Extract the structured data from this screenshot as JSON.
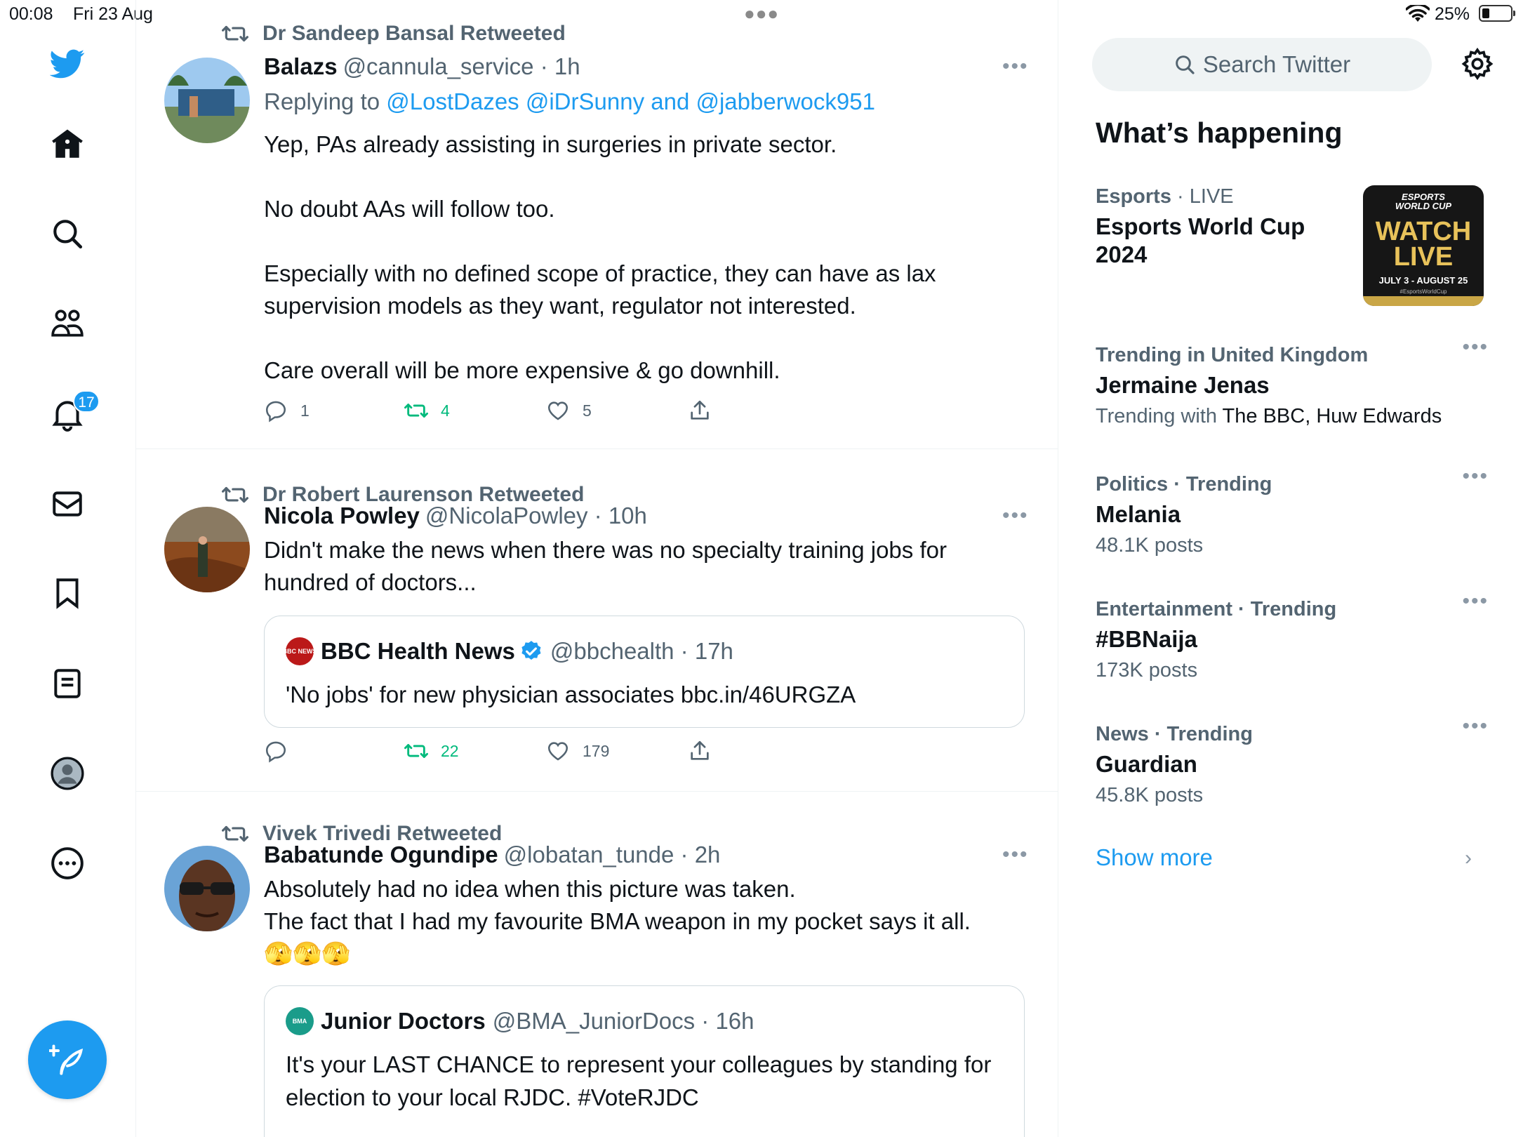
{
  "status_bar": {
    "time": "00:08",
    "date": "Fri 23 Aug",
    "battery": "25%"
  },
  "nav": {
    "notifications_badge": "17"
  },
  "tweets": [
    {
      "retweeted_by": "Dr Sandeep Bansal Retweeted",
      "name": "Balazs",
      "handle": "@cannula_service · 1h",
      "replying_prefix": "Replying to ",
      "replying_to": "@LostDazes @iDrSunny and @jabberwock951",
      "text": [
        "Yep, PAs already assisting in surgeries in private sector.",
        "",
        "No doubt AAs will follow too.",
        "",
        "Especially with no defined scope of practice, they can have as lax supervision models as they want, regulator not interested.",
        "",
        "Care overall will be more expensive & go downhill."
      ],
      "replies": "1",
      "retweets": "4",
      "likes": "5"
    },
    {
      "retweeted_by": "Dr Robert Laurenson Retweeted",
      "name": "Nicola Powley",
      "handle": "@NicolaPowley · 10h",
      "text": "Didn't make the news when there was no specialty training jobs for hundred of doctors...",
      "quote": {
        "name": "BBC Health News",
        "handle": "@bbchealth · 17h",
        "icon_label": "BBC NEWS",
        "text": "'No jobs' for new physician associates bbc.in/46URGZA"
      },
      "replies": "",
      "retweets": "22",
      "likes": "179"
    },
    {
      "retweeted_by": "Vivek Trivedi Retweeted",
      "name": "Babatunde Ogundipe",
      "handle": "@lobatan_tunde · 2h",
      "text": [
        "Absolutely had no idea when this picture was taken.",
        "The fact that I had my favourite BMA weapon in my pocket says it all.",
        "🫣🫣🫣"
      ],
      "quote": {
        "name": "Junior Doctors",
        "handle": "@BMA_JuniorDocs · 16h",
        "icon_label": "BMA",
        "text": "It's your LAST CHANCE to represent your colleagues by standing for election to your local RJDC. #VoteRJDC"
      }
    }
  ],
  "right": {
    "search_placeholder": "Search Twitter",
    "title": "What’s happening",
    "esports": {
      "cat": "Esports",
      "live": " · LIVE",
      "topic": "Esports World Cup 2024",
      "thumb_top": "ESPORTS WORLD CUP",
      "thumb_main": "WATCH LIVE",
      "thumb_dates": "JULY 3 - AUGUST 25",
      "thumb_tag": "#EsportsWorldCup"
    },
    "trends": [
      {
        "cat": "Trending in United Kingdom",
        "topic": "Jermaine Jenas",
        "count_prefix": "Trending with ",
        "count": "The BBC, Huw Edwards"
      },
      {
        "cat": "Politics · Trending",
        "topic": "Melania",
        "count": "48.1K posts"
      },
      {
        "cat": "Entertainment · Trending",
        "topic": "#BBNaija",
        "count": "173K posts"
      },
      {
        "cat": "News · Trending",
        "topic": "Guardian",
        "count": "45.8K posts"
      }
    ],
    "show_more": "Show more"
  },
  "colors": {
    "accent": "#1d9bf0",
    "retweet_green": "#00ba7c",
    "secondary_text": "#536471",
    "border": "#eff3f4"
  },
  "icons": [
    "twitter-logo-icon",
    "home-icon",
    "search-icon",
    "communities-icon",
    "notifications-icon",
    "messages-icon",
    "bookmarks-icon",
    "lists-icon",
    "profile-icon",
    "more-icon",
    "compose-icon",
    "retweet-icon",
    "reply-icon",
    "like-icon",
    "share-icon",
    "verified-icon",
    "settings-icon",
    "chevron-right-icon"
  ]
}
